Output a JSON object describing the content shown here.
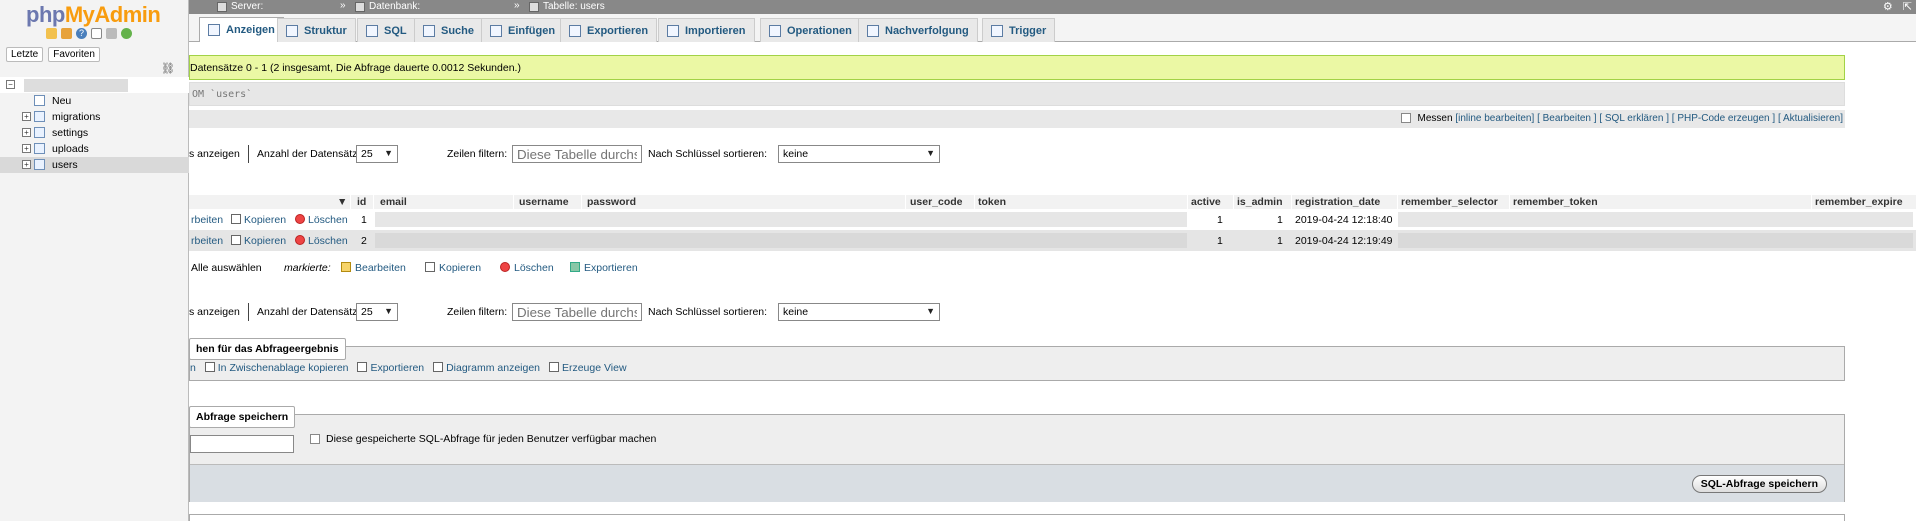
{
  "sidebar": {
    "logo": {
      "prefix": "php",
      "brand": "MyAdmin"
    },
    "tabs": [
      "Letzte",
      "Favoriten"
    ],
    "tree": [
      {
        "label": "Neu",
        "type": "new"
      },
      {
        "label": "migrations",
        "type": "table"
      },
      {
        "label": "settings",
        "type": "table"
      },
      {
        "label": "uploads",
        "type": "table"
      },
      {
        "label": "users",
        "type": "table",
        "selected": true
      }
    ]
  },
  "topbar": {
    "server": "Server:",
    "database": "Datenbank:",
    "table": "Tabelle: users"
  },
  "tabs": [
    {
      "label": "Anzeigen",
      "active": true
    },
    {
      "label": "Struktur"
    },
    {
      "label": "SQL"
    },
    {
      "label": "Suche"
    },
    {
      "label": "Einfügen"
    },
    {
      "label": "Exportieren"
    },
    {
      "label": "Importieren"
    },
    {
      "label": "Operationen"
    },
    {
      "label": "Nachverfolgung"
    },
    {
      "label": "Trigger"
    }
  ],
  "notice": {
    "text": "Datensätze 0 - 1 (2 insgesamt, Die Abfrage dauerte 0.0012 Sekunden.)"
  },
  "sql": {
    "text": "OM `users`"
  },
  "tools": {
    "measure": "Messen",
    "links": [
      "[inline bearbeiten]",
      "[ Bearbeiten ]",
      "[ SQL erklären ]",
      "[ PHP-Code erzeugen ]",
      "[ Aktualisieren]"
    ]
  },
  "nav": {
    "show": "s anzeigen",
    "rows_label": "Anzahl der Datensätze:",
    "rows_value": "25",
    "filter_label": "Zeilen filtern:",
    "filter_placeholder": "Diese Tabelle durchsuchen",
    "sort_label": "Nach Schlüssel sortieren:",
    "sort_value": "keine"
  },
  "table": {
    "columns": [
      "id",
      "email",
      "username",
      "password",
      "user_code",
      "token",
      "active",
      "is_admin",
      "registration_date",
      "remember_selector",
      "remember_token",
      "remember_expire"
    ],
    "rows": [
      {
        "edit": "rbeiten",
        "copy": "Kopieren",
        "delete": "Löschen",
        "id": "1",
        "active": "1",
        "is_admin": "1",
        "registration_date": "2019-04-24 12:18:40"
      },
      {
        "edit": "rbeiten",
        "copy": "Kopieren",
        "delete": "Löschen",
        "id": "2",
        "active": "1",
        "is_admin": "1",
        "registration_date": "2019-04-24 12:19:49"
      }
    ]
  },
  "bulk": {
    "select_all": "Alle auswählen",
    "marked": "markierte:",
    "edit": "Bearbeiten",
    "copy": "Kopieren",
    "delete": "Löschen",
    "export": "Exportieren"
  },
  "ops": {
    "legend": "hen für das Abfrageergebnis",
    "links": [
      "n",
      "In Zwischenablage kopieren",
      "Exportieren",
      "Diagramm anzeigen",
      "Erzeuge View"
    ]
  },
  "bookmark": {
    "legend": "Abfrage speichern",
    "share_label": "Diese gespeicherte SQL-Abfrage für jeden Benutzer verfügbar machen",
    "button": "SQL-Abfrage speichern"
  }
}
